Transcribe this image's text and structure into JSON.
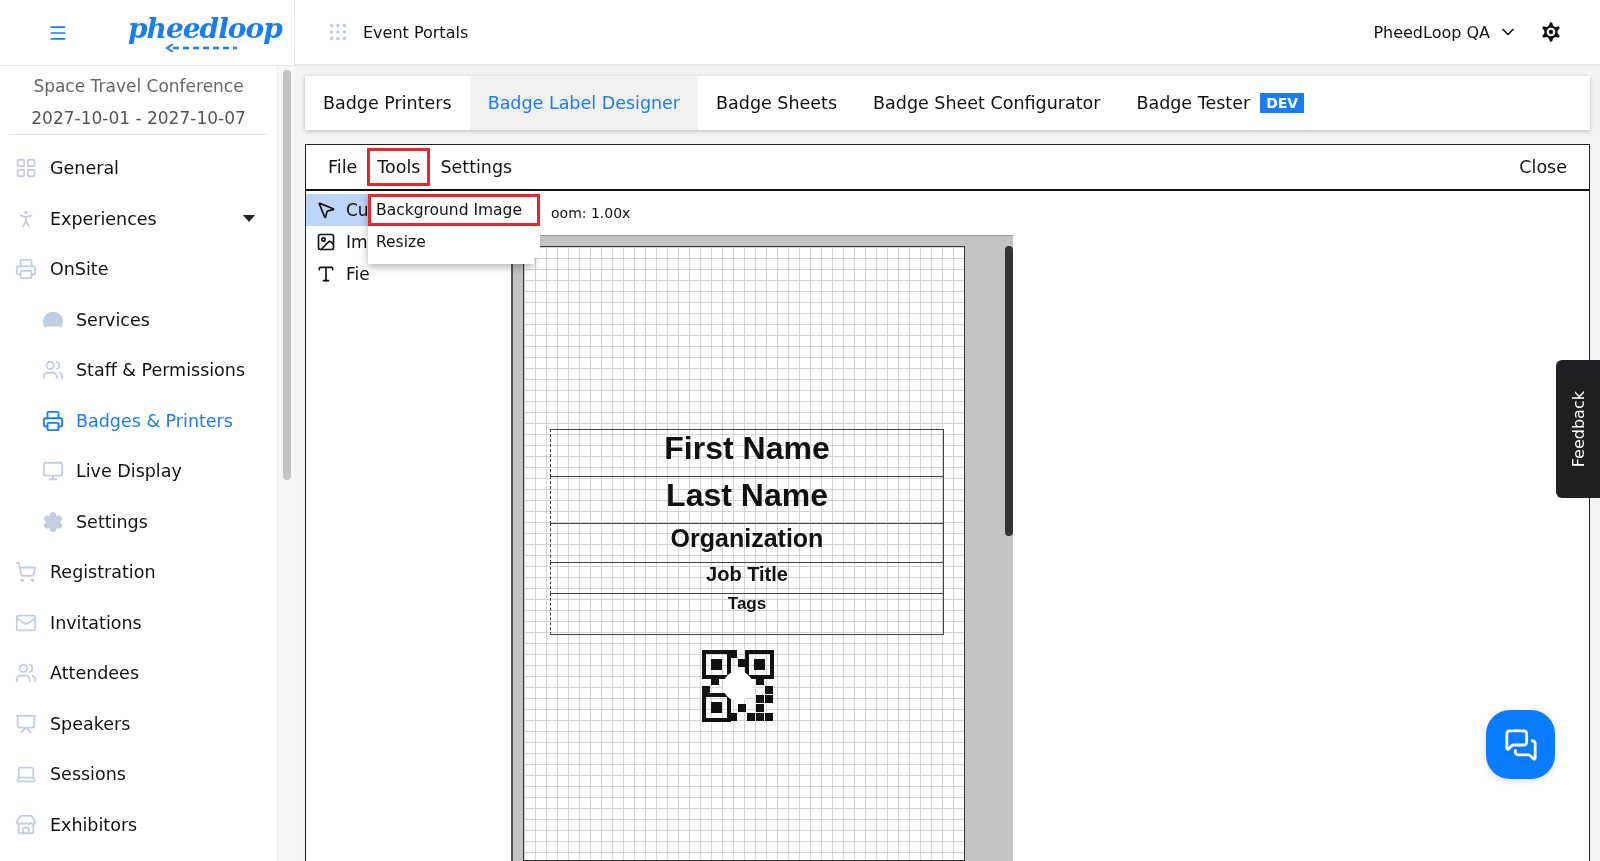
{
  "header": {
    "logo": "pheedloop",
    "portal_link": "Event Portals",
    "account": "PheedLoop QA"
  },
  "sidebar": {
    "event_name": "Space Travel Conference",
    "event_dates": "2027-10-01 - 2027-10-07",
    "items": [
      {
        "label": "General",
        "selected": false
      },
      {
        "label": "Experiences",
        "selected": false,
        "expanded": false
      },
      {
        "label": "OnSite",
        "selected": false,
        "children": [
          {
            "label": "Services",
            "selected": false
          },
          {
            "label": "Staff & Permissions",
            "selected": false
          },
          {
            "label": "Badges & Printers",
            "selected": true
          },
          {
            "label": "Live Display",
            "selected": false
          },
          {
            "label": "Settings",
            "selected": false
          }
        ]
      },
      {
        "label": "Registration",
        "selected": false
      },
      {
        "label": "Invitations",
        "selected": false
      },
      {
        "label": "Attendees",
        "selected": false
      },
      {
        "label": "Speakers",
        "selected": false
      },
      {
        "label": "Sessions",
        "selected": false
      },
      {
        "label": "Exhibitors",
        "selected": false
      }
    ]
  },
  "tabs": [
    {
      "label": "Badge Printers",
      "selected": false
    },
    {
      "label": "Badge Label Designer",
      "selected": true
    },
    {
      "label": "Badge Sheets",
      "selected": false
    },
    {
      "label": "Badge Sheet Configurator",
      "selected": false
    },
    {
      "label": "Badge Tester",
      "selected": false,
      "badge": "DEV"
    }
  ],
  "designer": {
    "menu": [
      {
        "label": "File",
        "highlighted": false
      },
      {
        "label": "Tools",
        "highlighted": true
      },
      {
        "label": "Settings",
        "highlighted": false
      }
    ],
    "close": "Close",
    "tools": [
      {
        "label": "Cu",
        "selected": true
      },
      {
        "label": "Im",
        "selected": false
      },
      {
        "label": "Fie",
        "selected": false
      }
    ],
    "dropdown": [
      {
        "label": "Background Image",
        "highlighted": true
      },
      {
        "label": "Resize",
        "highlighted": false
      }
    ],
    "zoom": "oom: 1.00x",
    "fields": [
      {
        "label": "First Name"
      },
      {
        "label": "Last Name"
      },
      {
        "label": "Organization"
      },
      {
        "label": "Job Title"
      },
      {
        "label": "Tags"
      }
    ]
  },
  "feedback": "Feedback"
}
